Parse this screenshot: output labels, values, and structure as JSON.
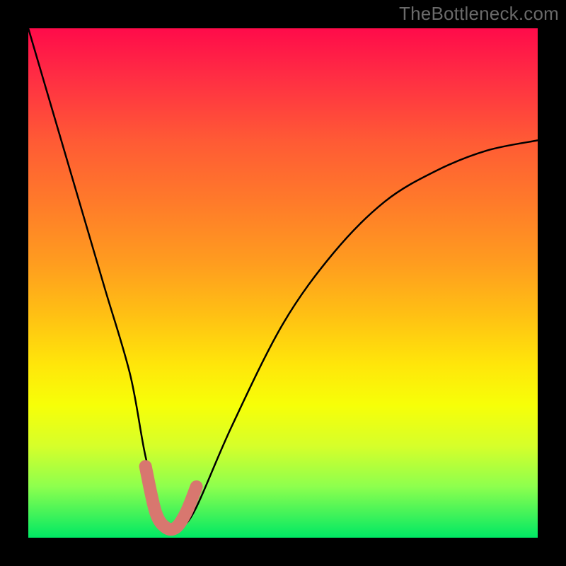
{
  "watermark": "TheBottleneck.com",
  "colors": {
    "background": "#000000",
    "gradient_top": "#ff0b4a",
    "gradient_bottom": "#00e864",
    "curve": "#000000",
    "trough": "#d8776f"
  },
  "chart_data": {
    "type": "line",
    "title": "",
    "xlabel": "",
    "ylabel": "",
    "xlim": [
      0,
      100
    ],
    "ylim": [
      0,
      100
    ],
    "series": [
      {
        "name": "bottleneck-curve",
        "x": [
          0,
          5,
          10,
          15,
          20,
          23,
          26,
          28,
          30,
          33,
          40,
          50,
          60,
          70,
          80,
          90,
          100
        ],
        "y": [
          100,
          83,
          66,
          49,
          32,
          16,
          5,
          2,
          2,
          6,
          22,
          42,
          56,
          66,
          72,
          76,
          78
        ]
      }
    ],
    "annotations": [
      {
        "name": "trough-highlight",
        "type": "path",
        "x": [
          23,
          25,
          27,
          29,
          31,
          33
        ],
        "y": [
          14,
          5,
          2,
          2,
          5,
          10
        ]
      }
    ]
  }
}
